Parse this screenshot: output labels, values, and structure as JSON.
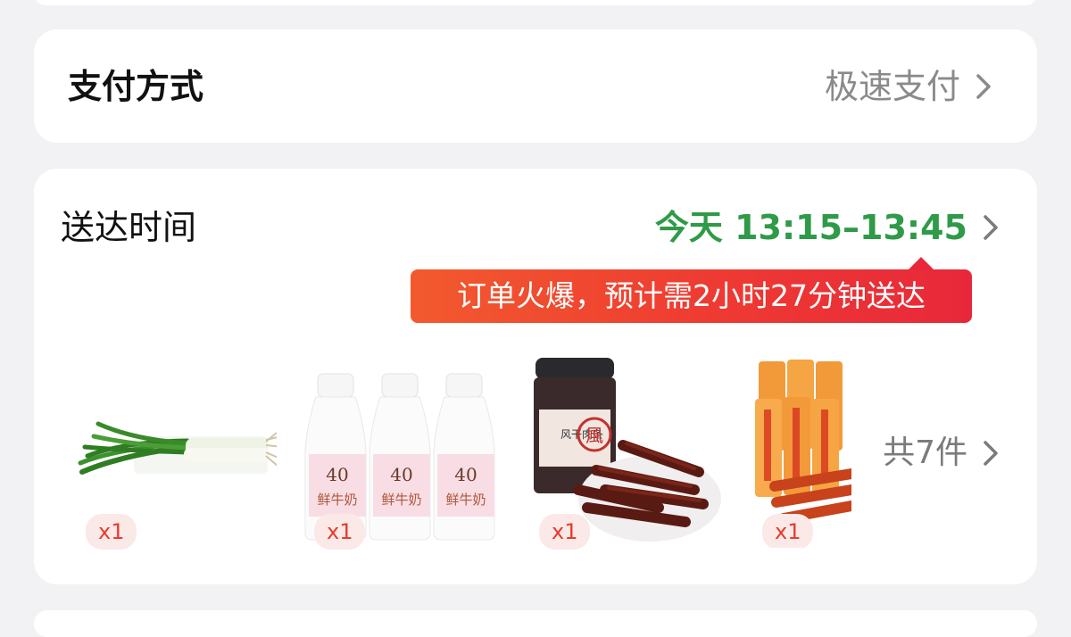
{
  "payment": {
    "title": "支付方式",
    "value": "极速支付"
  },
  "delivery": {
    "title": "送达时间",
    "time": "今天 13:15–13:45",
    "notice": "订单火爆，预计需2小时27分钟送达",
    "total": "共7件",
    "products": [
      {
        "icon": "green-onion-image",
        "qty": "x1"
      },
      {
        "icon": "milk-bottles-image",
        "qty": "x1",
        "label_big": "40",
        "label_name": "鲜牛奶"
      },
      {
        "icon": "dried-beef-image",
        "qty": "x1",
        "label_name": "风干肉条",
        "label_seal": "風"
      },
      {
        "icon": "spicy-strips-image",
        "qty": "x1"
      }
    ]
  },
  "colors": {
    "accent_green": "#2f9a47",
    "notice_red": "#ee3a32",
    "qty_text": "#e83a2f",
    "qty_bg": "#fbe9e7"
  }
}
